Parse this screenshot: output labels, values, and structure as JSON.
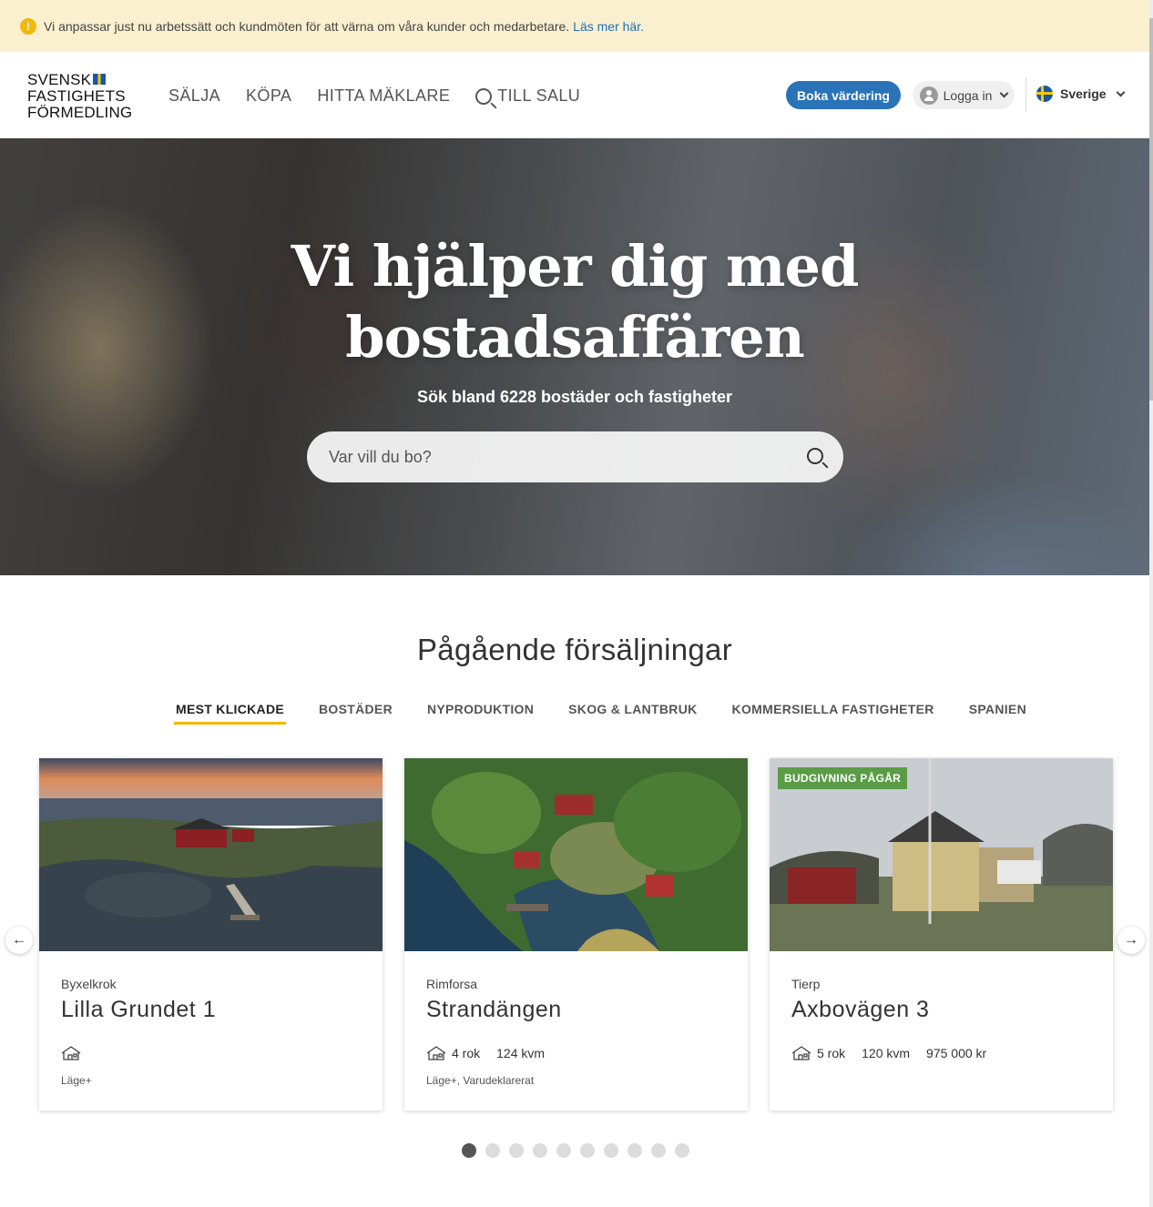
{
  "notice": {
    "text": "Vi anpassar just nu arbetssätt och kundmöten för att värna om våra kunder och medarbetare.",
    "link": "Läs mer här."
  },
  "header": {
    "logo_lines": [
      "SVENSK",
      "FASTIGHETS",
      "FÖRMEDLING"
    ],
    "nav": [
      "SÄLJA",
      "KÖPA",
      "HITTA MÄKLARE",
      "TILL SALU"
    ],
    "boka_label": "Boka värdering",
    "login_label": "Logga in",
    "country_label": "Sverige"
  },
  "hero": {
    "title_line1": "Vi hjälper dig med",
    "title_line2": "bostadsaffären",
    "subtitle": "Sök bland 6228 bostäder och fastigheter",
    "search_placeholder": "Var vill du bo?"
  },
  "section": {
    "title": "Pågående försäljningar",
    "tabs": [
      "MEST KLICKADE",
      "BOSTÄDER",
      "NYPRODUKTION",
      "SKOG & LANTBRUK",
      "KOMMERSIELLA FASTIGHETER",
      "SPANIEN"
    ],
    "active_tab": "MEST KLICKADE"
  },
  "cards": [
    {
      "location": "Byxelkrok",
      "title": "Lilla Grundet 1",
      "rooms": "",
      "area": "",
      "price": "",
      "tags": "Läge+",
      "badge": ""
    },
    {
      "location": "Rimforsa",
      "title": "Strandängen",
      "rooms": "4 rok",
      "area": "124 kvm",
      "price": "",
      "tags": "Läge+, Varudeklarerat",
      "badge": ""
    },
    {
      "location": "Tierp",
      "title": "Axbovägen 3",
      "rooms": "5 rok",
      "area": "120 kvm",
      "price": "975 000 kr",
      "tags": "",
      "badge": "BUDGIVNING PÅGÅR"
    }
  ],
  "carousel": {
    "pages": 10,
    "active_page": 1,
    "prev_arrow": "←",
    "next_arrow": "→"
  },
  "colors": {
    "accent_blue": "#2a73b8",
    "tab_underline": "#f2b705",
    "badge_green": "#5a9c45",
    "notice_bg": "#faf0cf"
  }
}
